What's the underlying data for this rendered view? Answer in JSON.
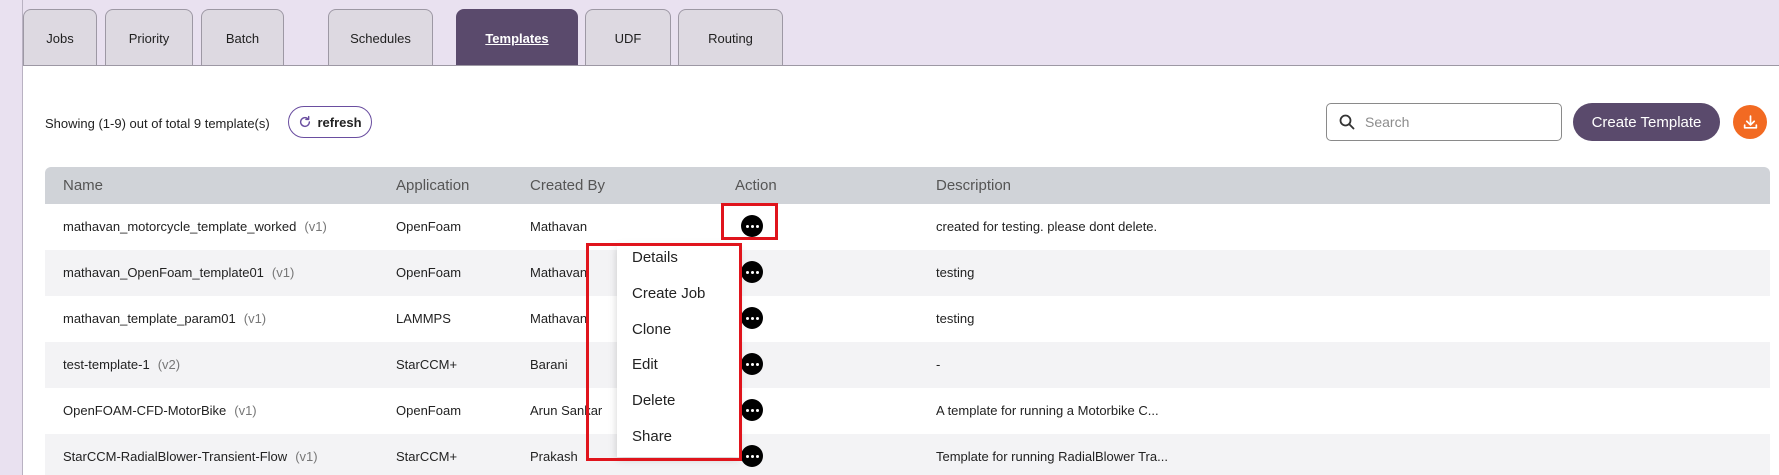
{
  "tabs": [
    {
      "label": "Jobs",
      "active": false
    },
    {
      "label": "Priority",
      "active": false
    },
    {
      "label": "Batch",
      "active": false
    },
    {
      "label": "Schedules",
      "active": false
    },
    {
      "label": "Templates",
      "active": true
    },
    {
      "label": "UDF",
      "active": false
    },
    {
      "label": "Routing",
      "active": false
    }
  ],
  "toolbar": {
    "showing_text": "Showing (1-9) out of total 9 template(s)",
    "refresh_label": "refresh",
    "search_placeholder": "Search",
    "create_label": "Create Template"
  },
  "table": {
    "headers": {
      "name": "Name",
      "application": "Application",
      "created_by": "Created By",
      "action": "Action",
      "description": "Description"
    },
    "rows": [
      {
        "name": "mathavan_motorcycle_template_worked",
        "version": "(v1)",
        "application": "OpenFoam",
        "created_by": "Mathavan",
        "description": "created for testing. please dont delete."
      },
      {
        "name": "mathavan_OpenFoam_template01",
        "version": "(v1)",
        "application": "OpenFoam",
        "created_by": "Mathavan",
        "description": "testing"
      },
      {
        "name": "mathavan_template_param01",
        "version": "(v1)",
        "application": "LAMMPS",
        "created_by": "Mathavan",
        "description": "testing"
      },
      {
        "name": "test-template-1",
        "version": "(v2)",
        "application": "StarCCM+",
        "created_by": "Barani",
        "description": "-"
      },
      {
        "name": "OpenFOAM-CFD-MotorBike",
        "version": "(v1)",
        "application": "OpenFoam",
        "created_by": "Arun Sankar",
        "description": "A template for running a Motorbike C..."
      },
      {
        "name": "StarCCM-RadialBlower-Transient-Flow",
        "version": "(v1)",
        "application": "StarCCM+",
        "created_by": "Prakash",
        "description": "Template for running RadialBlower Tra..."
      }
    ]
  },
  "action_menu": {
    "items": [
      "Details",
      "Create Job",
      "Clone",
      "Edit",
      "Delete",
      "Share"
    ]
  },
  "icons": {
    "refresh": "refresh-icon",
    "search": "search-icon",
    "download": "download-icon",
    "more": "more-horizontal-icon"
  },
  "colors": {
    "accent": "#5a4a6c",
    "download": "#f26a22",
    "highlight": "#e0141c",
    "refresh_border": "#6a4ea0"
  }
}
